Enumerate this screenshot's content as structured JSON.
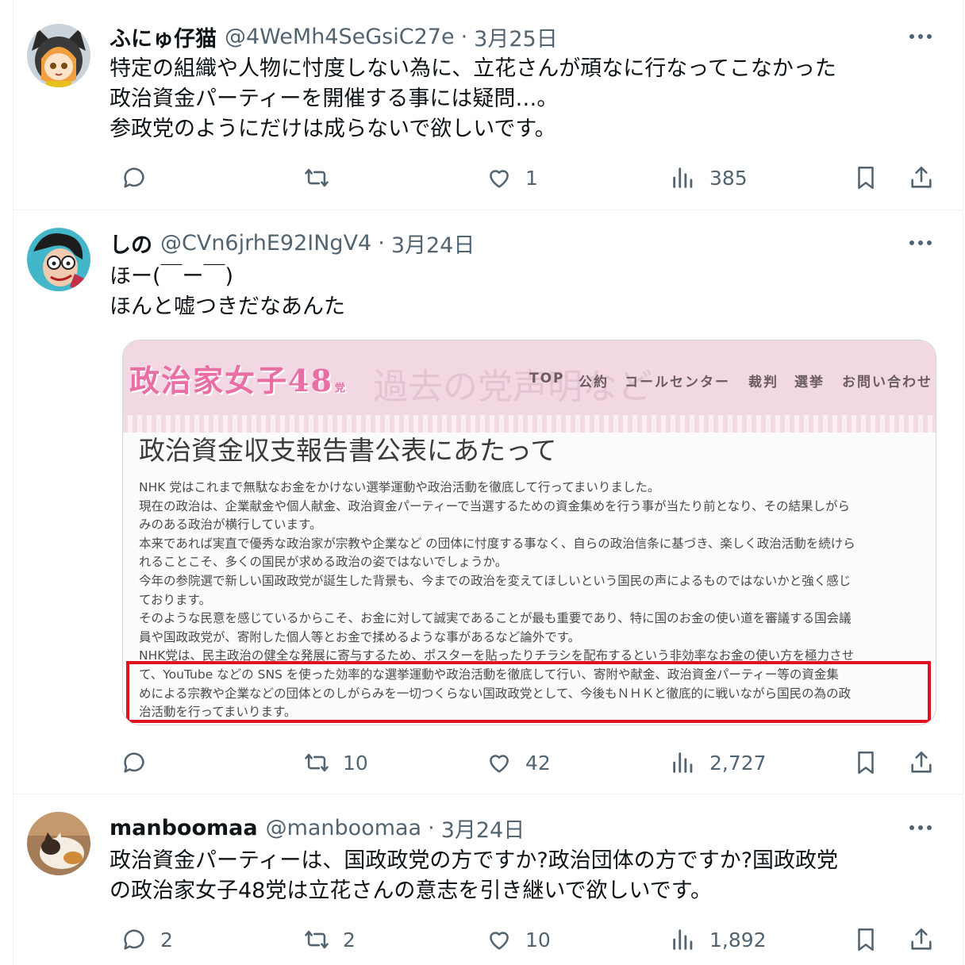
{
  "tweets": [
    {
      "name": "ふにゅ仔猫",
      "handle": "@4WeMh4SeGsiC27e",
      "date": "3月25日",
      "lines": [
        "特定の組織や人物に忖度しない為に、立花さんが頑なに行なってこなかった",
        "政治資金パーティーを開催する事には疑問…。",
        "参政党のようにだけは成らないで欲しいです。"
      ],
      "replies": "",
      "reposts": "",
      "likes": "1",
      "views": "385"
    },
    {
      "name": "しの",
      "handle": "@CVn6jrhE92INgV4",
      "date": "3月24日",
      "lines": [
        "ほー(￣ー￣)",
        "ほんと嘘つきだなあんた"
      ],
      "replies": "",
      "reposts": "10",
      "likes": "42",
      "views": "2,727",
      "card": {
        "logo": "政治家女子48",
        "logo_suffix": "党",
        "ghost_text": "過去の党声明など",
        "nav": [
          "TOP",
          "公約",
          "コールセンター",
          "裁判",
          "選挙",
          "お問い合わせ"
        ],
        "title": "政治資金収支報告書公表にあたって",
        "body": [
          "NHK 党はこれまで無駄なお金をかけない選挙運動や政治活動を徹底して行ってまいりました。",
          "現在の政治は、企業献金や個人献金、政治資金パーティーで当選するための資金集めを行う事が当たり前となり、その結果しがら",
          "みのある政治が横行しています。",
          "本来であれば実直で優秀な政治家が宗教や企業など の団体に忖度する事なく、自らの政治信条に基づき、楽しく政治活動を続けら",
          "れることこそ、多くの国民が求める政治の姿ではないでしょうか。",
          "今年の参院選で新しい国政政党が誕生した背景も、今までの政治を変えてほしいという国民の声によるものではないかと強く感じ",
          "ております。",
          "そのような民意を感じているからこそ、お金に対して誠実であることが最も重要であり、特に国のお金の使い道を審議する国会議",
          "員や国政政党が、寄附した個人等とお金で揉めるような事があるなど論外です。",
          "NHK党は、民主政治の健全な発展に寄与するため、ポスターを貼ったりチラシを配布するという非効率なお金の使い方を極力させ",
          "て、YouTube などの SNS を使った効率的な選挙運動や政治活動を徹底して行い、寄附や献金、政治資金パーティー等の資金集",
          "めによる宗教や企業などの団体とのしがらみを一切つくらない国政政党として、今後もＮＨＫと徹底的に戦いながら国民の為の政",
          "治活動を行ってまいります。"
        ]
      }
    },
    {
      "name": "manboomaa",
      "handle": "@manboomaa",
      "date": "3月24日",
      "lines": [
        "政治資金パーティーは、国政政党の方ですか?政治団体の方ですか?国政政党",
        "の政治家女子48党は立花さんの意志を引き継いで欲しいです。"
      ],
      "replies": "2",
      "reposts": "2",
      "likes": "10",
      "views": "1,892"
    }
  ],
  "colors": {
    "text": "#0f1419",
    "secondary": "#536471",
    "border": "#eff3f4",
    "highlight": "#e0101c",
    "card_pink": "#f1d8e3"
  }
}
